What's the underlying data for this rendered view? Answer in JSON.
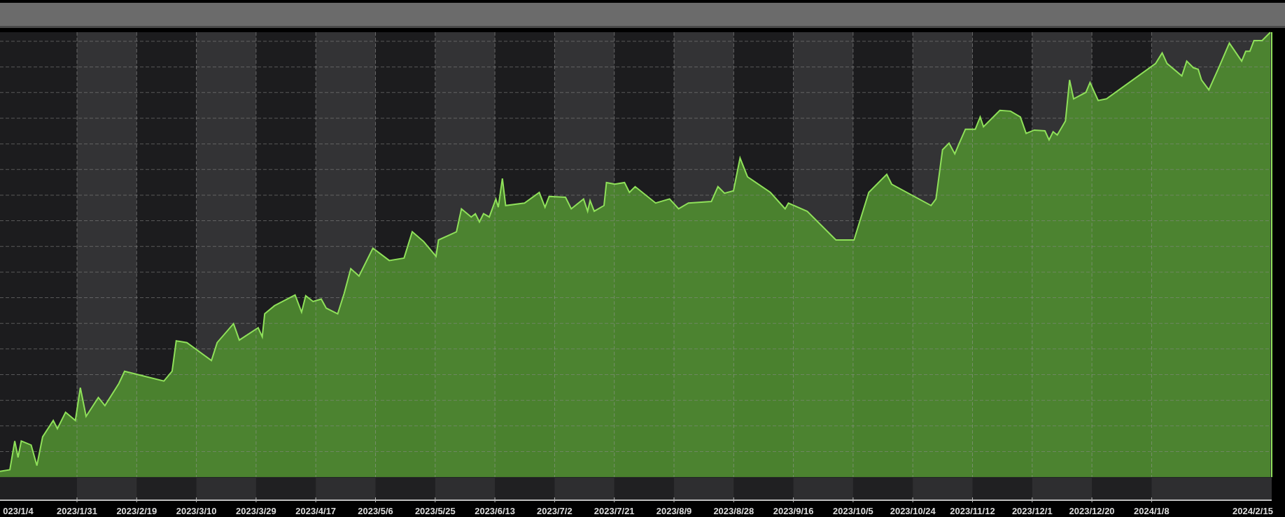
{
  "x_axis": {
    "labels": [
      "023/1/4",
      "2023/1/31",
      "2023/2/19",
      "2023/3/10",
      "2023/3/29",
      "2023/4/17",
      "2023/5/6",
      "2023/5/25",
      "2023/6/13",
      "2023/7/2",
      "2023/7/21",
      "2023/8/9",
      "2023/8/28",
      "2023/9/16",
      "2023/10/5",
      "2023/10/24",
      "2023/11/12",
      "2023/12/1",
      "2023/12/20",
      "2024/1/8",
      "2024/2/15"
    ]
  }
}
